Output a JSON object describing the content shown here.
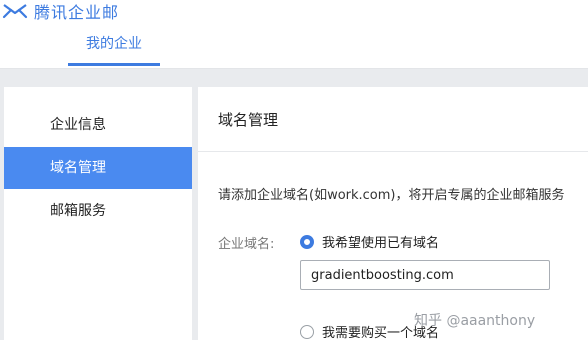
{
  "app": {
    "brand_name": "腾讯企业邮"
  },
  "header": {
    "nav_tab": "我的企业"
  },
  "sidebar": {
    "items": [
      {
        "label": "企业信息"
      },
      {
        "label": "域名管理"
      },
      {
        "label": "邮箱服务"
      }
    ]
  },
  "main": {
    "title": "域名管理",
    "description": "请添加企业域名(如work.com)，将开启专属的企业邮箱服务",
    "field_label": "企业域名:",
    "option_existing": "我希望使用已有域名",
    "option_buy": "我需要购买一个域名",
    "domain_value": "gradientboosting.com"
  },
  "watermark": "知乎 @aaanthony",
  "colors": {
    "accent": "#3d7be0",
    "active_item_bg": "#4a8af0"
  }
}
